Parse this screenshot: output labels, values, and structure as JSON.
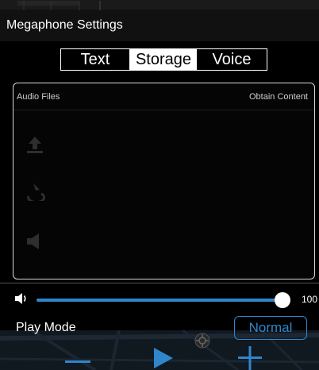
{
  "header": {
    "title": "Megaphone Settings"
  },
  "tabs": [
    {
      "label": "Text",
      "selected": false
    },
    {
      "label": "Storage",
      "selected": true
    },
    {
      "label": "Voice",
      "selected": false
    }
  ],
  "files": {
    "left_label": "Audio Files",
    "right_label": "Obtain Content",
    "faint_icons": [
      "upload-icon",
      "rotate-icon",
      "speaker-icon"
    ]
  },
  "volume": {
    "icon": "speaker-icon",
    "value": 100,
    "value_label": "100"
  },
  "play_mode": {
    "label": "Play Mode",
    "button_label": "Normal"
  },
  "controls": {
    "minus": "minus-icon",
    "play": "play-icon",
    "plus": "plus-icon",
    "locate": "locate-icon"
  },
  "colors": {
    "accent": "#2f86cc",
    "background": "#000000",
    "panel_border": "#d9d9d9"
  }
}
